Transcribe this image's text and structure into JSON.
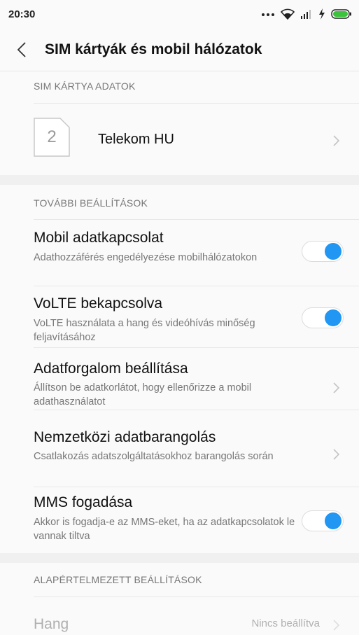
{
  "status_bar": {
    "time": "20:30",
    "icons": [
      "more-dots-icon",
      "wifi-icon",
      "signal-icon",
      "charging-icon",
      "battery-icon"
    ]
  },
  "header": {
    "title": "SIM kártyák és mobil hálózatok"
  },
  "sim_section": {
    "label": "SIM KÁRTYA ADATOK",
    "sim_slot_number": "2",
    "sim_name": "Telekom HU"
  },
  "more_section": {
    "label": "TOVÁBBI BEÁLLÍTÁSOK",
    "items": [
      {
        "title": "Mobil adatkapcsolat",
        "subtitle": "Adathozzáférés engedélyezése mobilhálózatokon",
        "control": "toggle",
        "on": true
      },
      {
        "title": "VoLTE bekapcsolva",
        "subtitle": "VoLTE használata a hang és videóhívás minőség feljavításához",
        "control": "toggle",
        "on": true
      },
      {
        "title": "Adatforgalom beállítása",
        "subtitle": "Állítson be adatkorlátot, hogy ellenőrizze a mobil adathasználatot",
        "control": "chevron"
      },
      {
        "title": "Nemzetközi adatbarangolás",
        "subtitle": "Csatlakozás adatszolgáltatásokhoz barangolás során",
        "control": "chevron"
      },
      {
        "title": "MMS fogadása",
        "subtitle": "Akkor is fogadja-e az MMS-eket, ha az adatkapcsolatok le vannak tiltva",
        "control": "toggle",
        "on": true
      }
    ]
  },
  "default_section": {
    "label": "ALAPÉRTELMEZETT BEÁLLÍTÁSOK",
    "items": [
      {
        "title": "Hang",
        "value": "Nincs beállítva"
      }
    ]
  },
  "colors": {
    "accent": "#2196f3",
    "background": "#fafafa",
    "secondary_text": "#777777",
    "disabled_text": "#b0b0b0"
  }
}
